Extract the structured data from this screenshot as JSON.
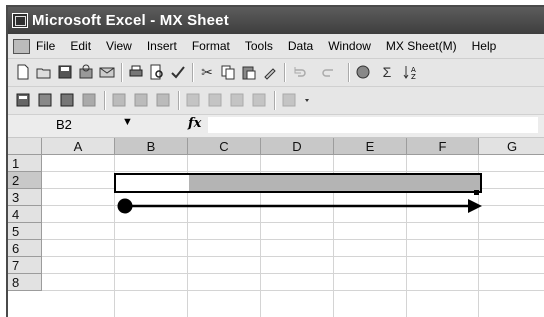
{
  "window": {
    "title": "Microsoft Excel - MX Sheet"
  },
  "menu": [
    "File",
    "Edit",
    "View",
    "Insert",
    "Format",
    "Tools",
    "Data",
    "Window",
    "MX Sheet(M)",
    "Help"
  ],
  "toolbar_std": {
    "autosum": "Σ",
    "cut": "✂",
    "icons": [
      "new-icon",
      "open-icon",
      "save-icon",
      "permission-icon",
      "email-icon",
      "print-icon",
      "print-preview-icon",
      "spelling-icon",
      "cut-icon",
      "copy-icon",
      "paste-icon",
      "format-painter-icon",
      "undo-icon",
      "redo-icon",
      "hyperlink-icon",
      "autosum-icon",
      "sort-ascending-icon"
    ]
  },
  "formula": {
    "name_box": "B2",
    "fx": "fx",
    "value": ""
  },
  "grid": {
    "columns": [
      "A",
      "B",
      "C",
      "D",
      "E",
      "F",
      "G"
    ],
    "rows": [
      "1",
      "2",
      "3",
      "4",
      "5",
      "6",
      "7",
      "8"
    ],
    "selected_range": "B2:F2"
  }
}
